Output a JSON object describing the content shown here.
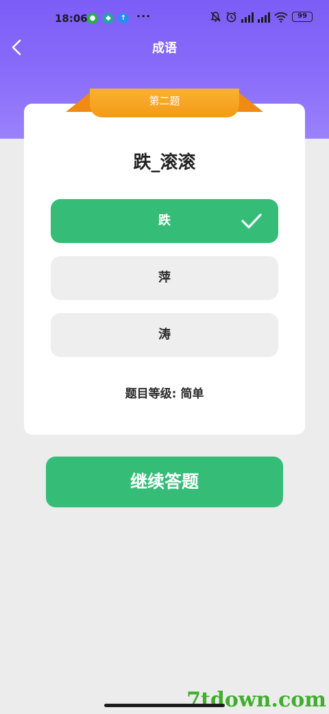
{
  "status_bar": {
    "time": "18:06",
    "battery": "99",
    "icons": [
      "wechat-icon",
      "shield-icon",
      "upload-icon",
      "mute-icon",
      "alarm-icon",
      "signal-icon",
      "wifi-icon",
      "battery-icon"
    ],
    "more": "···"
  },
  "nav": {
    "title": "成语",
    "back_icon": "chevron-left-icon"
  },
  "card": {
    "ribbon_label": "第二题",
    "question": "跌_滚滚",
    "options": [
      {
        "label": "跌",
        "state": "correct"
      },
      {
        "label": "萍",
        "state": "normal"
      },
      {
        "label": "涛",
        "state": "normal"
      }
    ],
    "level_text": "题目等级: 简单"
  },
  "continue_label": "继续答题",
  "watermark": "7tdown.com",
  "colors": {
    "header": "#7c5df7",
    "accent_green": "#35bd78",
    "ribbon_orange": "#f29a17"
  }
}
